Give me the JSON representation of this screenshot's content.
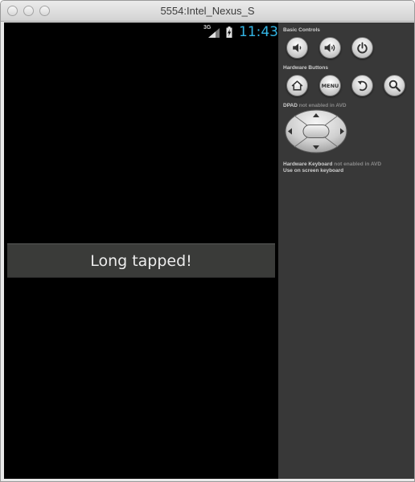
{
  "window": {
    "title": "5554:Intel_Nexus_S"
  },
  "statusbar": {
    "network_label": "3G",
    "clock": "11:43"
  },
  "toast": {
    "message": "Long tapped!"
  },
  "panel": {
    "basic_controls_label": "Basic Controls",
    "hardware_buttons_label": "Hardware Buttons",
    "menu_button_label": "MENU",
    "dpad_label": "DPAD",
    "dpad_note": " not enabled in AVD",
    "keyboard_label": "Hardware Keyboard",
    "keyboard_note": " not enabled in AVD",
    "keyboard_hint": "Use on screen keyboard"
  },
  "colors": {
    "clock": "#33b5e5",
    "screen_bg": "#000000",
    "panel_bg": "#383838",
    "toast_bg": "#3a3b39"
  }
}
